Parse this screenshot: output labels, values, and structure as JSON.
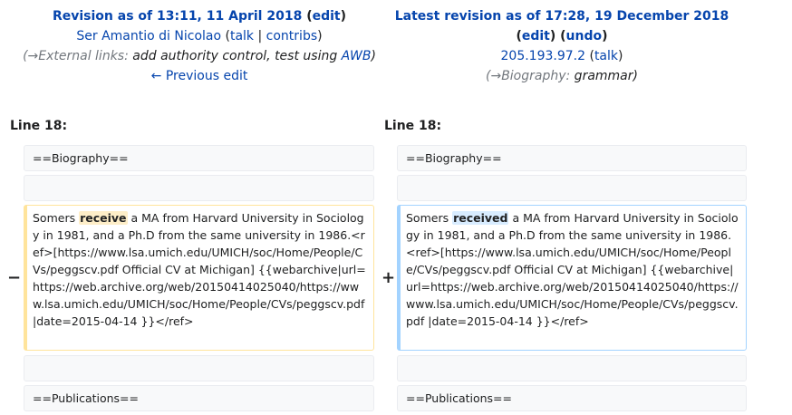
{
  "left_header": {
    "title_prefix": "Revision as of 13:11, 11 April 2018",
    "edit_label": "edit",
    "user": "Ser Amantio di Nicolao",
    "talk": "talk",
    "contribs": "contribs",
    "summary_arrow": "(→",
    "summary_section": "External links:",
    "summary_text": " add authority control, test using ",
    "summary_link": "AWB",
    "summary_close": ")",
    "prev_edit": "← Previous edit"
  },
  "right_header": {
    "title": "Latest revision as of 17:28, 19 December 2018",
    "edit_label": "edit",
    "undo_label": "undo",
    "ip": "205.193.97.2",
    "talk": "talk",
    "summary_arrow": "(→",
    "summary_section": "Biography:",
    "summary_text": "  grammar",
    "summary_close": ")"
  },
  "line_left": "Line 18:",
  "line_right": "Line 18:",
  "context_top": "==Biography==",
  "context_bottom": "==Publications==",
  "del_marker": "−",
  "add_marker": "+",
  "deleted": {
    "before": "Somers ",
    "changed": "receive",
    "after": " a MA from Harvard University in Sociology in 1981, and a Ph.D from the same university in 1986.<ref>[https://www.lsa.umich.edu/UMICH/soc/Home/People/CVs/peggscv.pdf Official CV at Michigan] {{webarchive|url=https://web.archive.org/web/20150414025040/https://www.lsa.umich.edu/UMICH/soc/Home/People/CVs/peggscv.pdf |date=2015-04-14 }}</ref>"
  },
  "added": {
    "before": "Somers ",
    "changed": "received",
    "after": " a MA from Harvard University in Sociology in 1981, and a Ph.D from the same university in 1986.<ref>[https://www.lsa.umich.edu/UMICH/soc/Home/People/CVs/peggscv.pdf Official CV at Michigan] {{webarchive|url=https://web.archive.org/web/20150414025040/https://www.lsa.umich.edu/UMICH/soc/Home/People/CVs/peggscv.pdf |date=2015-04-14 }}</ref>"
  }
}
